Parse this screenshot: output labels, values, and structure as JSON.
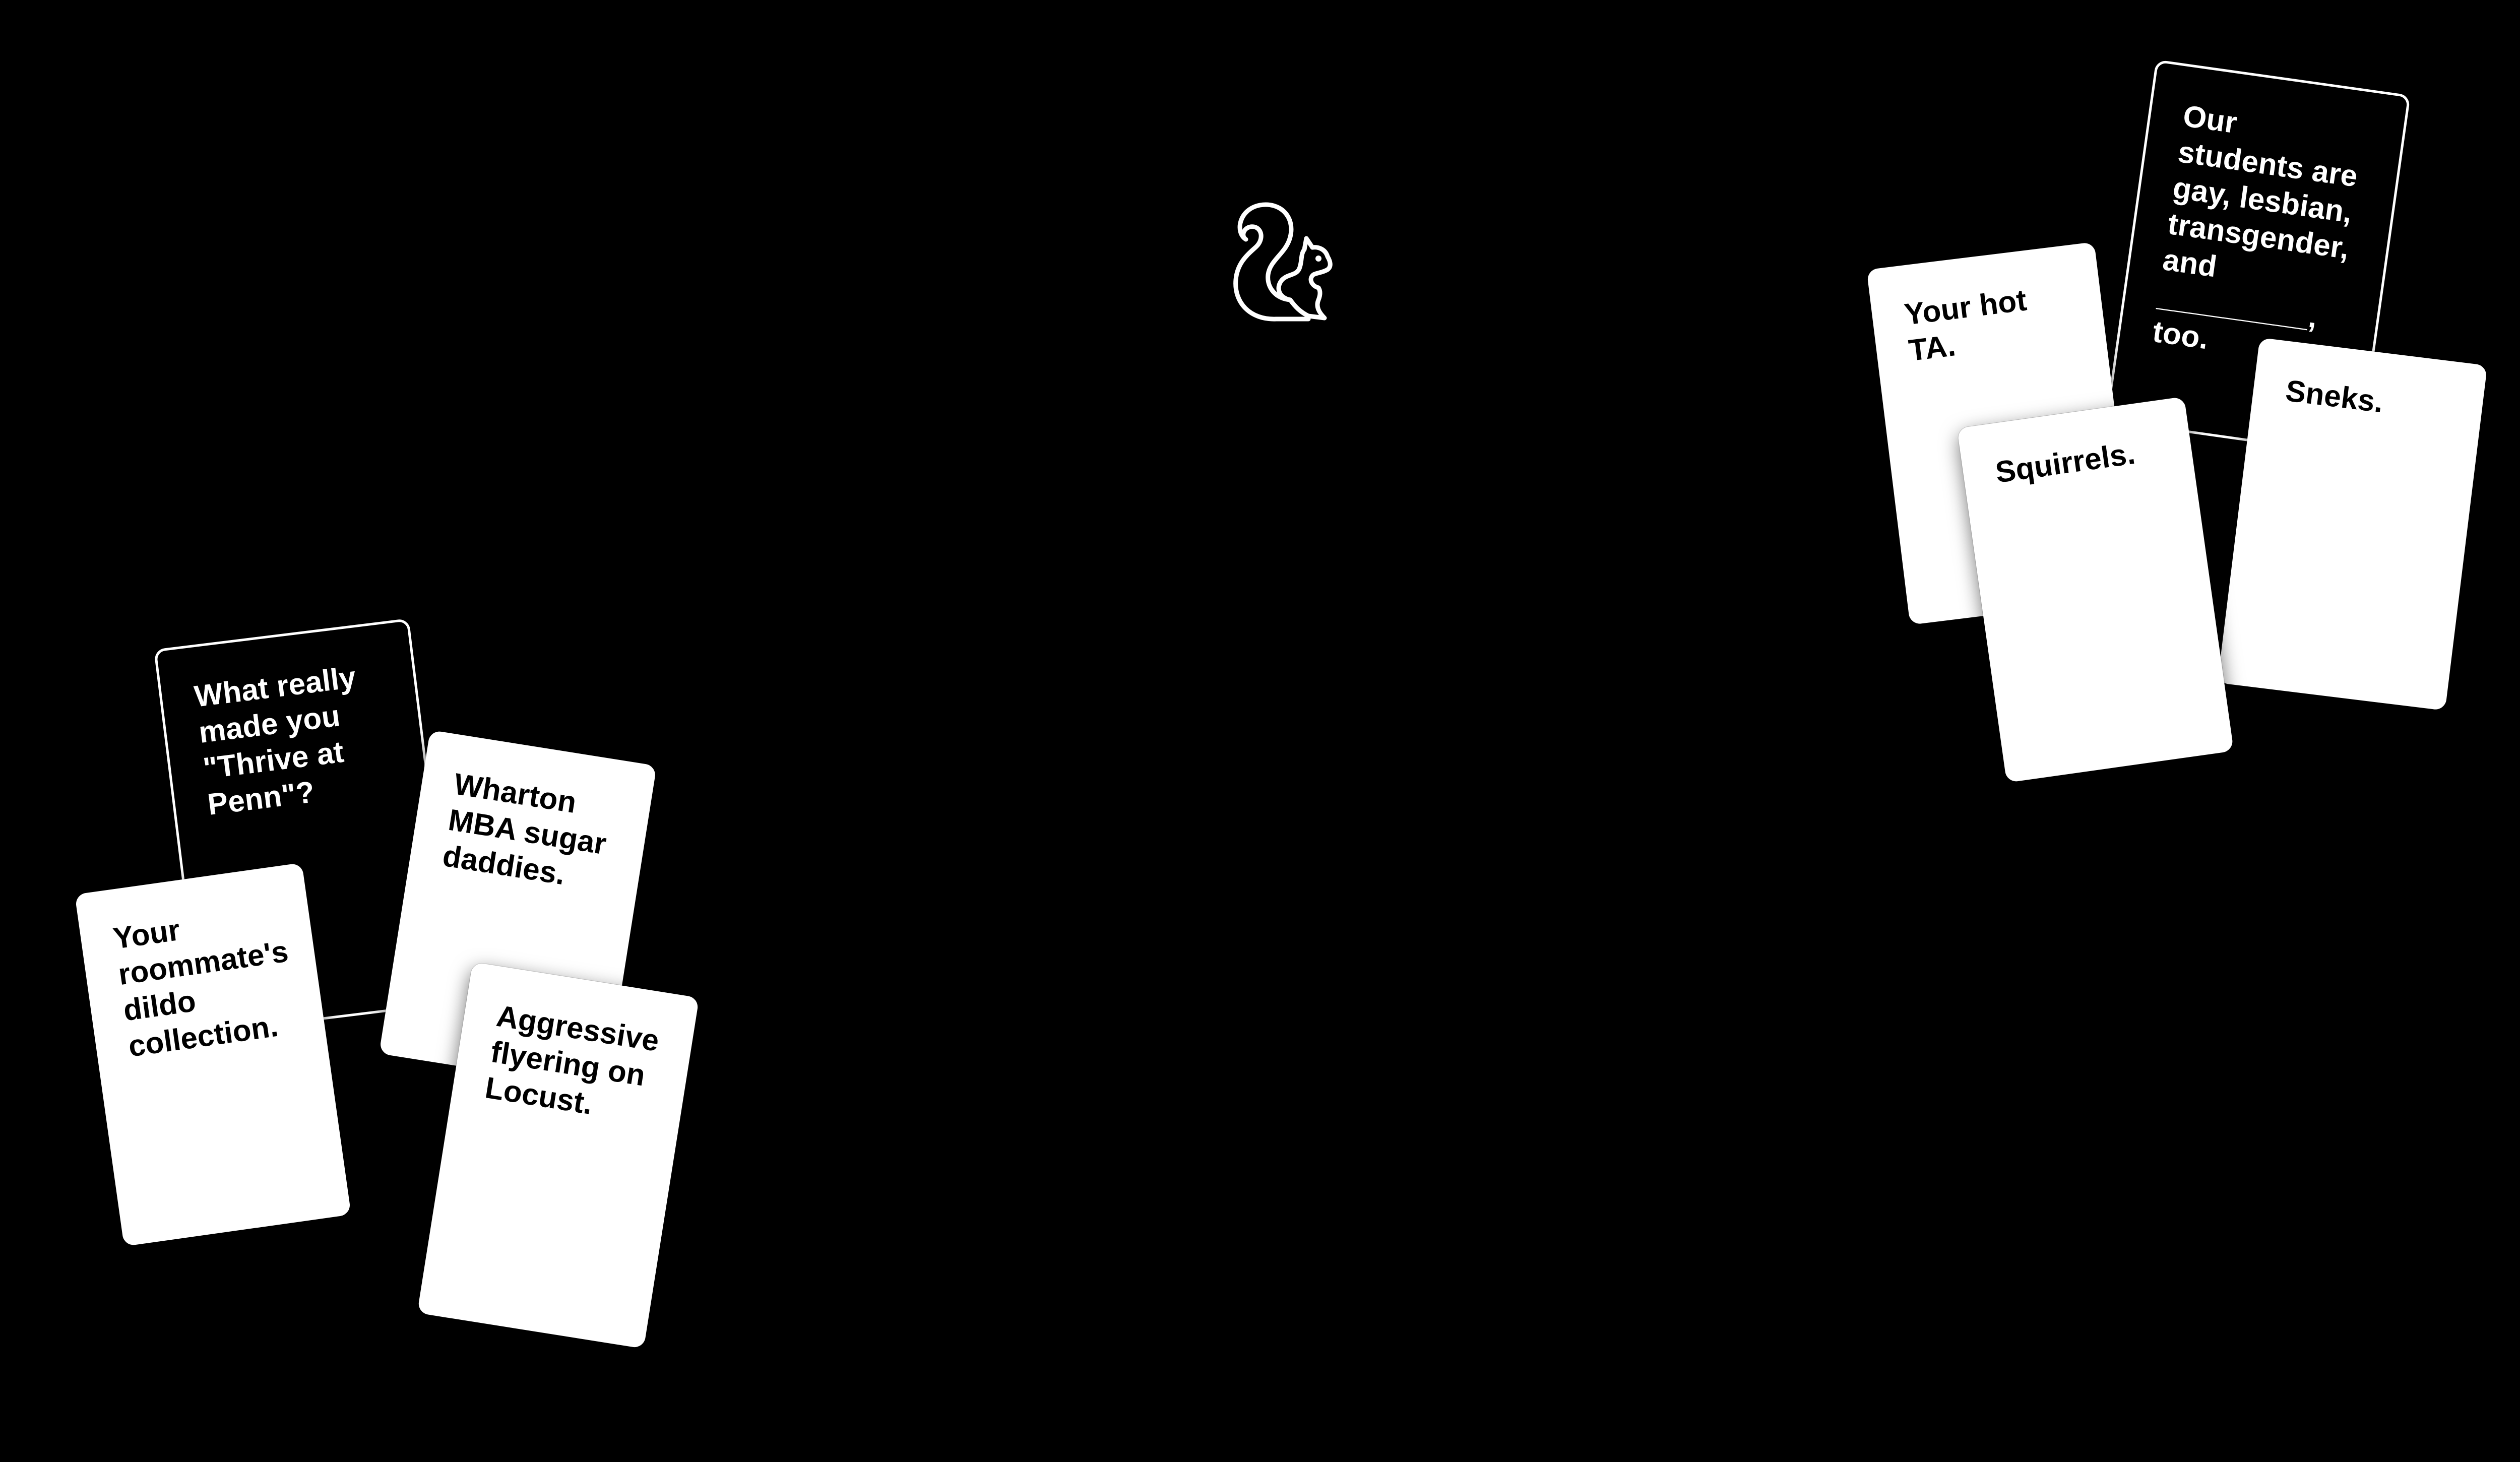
{
  "logo": {
    "icon": "squirrel-icon"
  },
  "left_group": {
    "prompt": "What really made you \"Thrive at Penn\"?",
    "answers": [
      "Your roommate's dildo collection.",
      "Wharton MBA sugar daddies.",
      "Aggressive flyering on Locust."
    ]
  },
  "right_group": {
    "prompt": "Our students are gay, lesbian, transgender, and _________, too.",
    "answers": [
      "Your hot TA.",
      "Squirrels.",
      "Sneks."
    ]
  },
  "colors": {
    "background": "#000000",
    "card_white": "#ffffff",
    "card_black": "#000000"
  }
}
